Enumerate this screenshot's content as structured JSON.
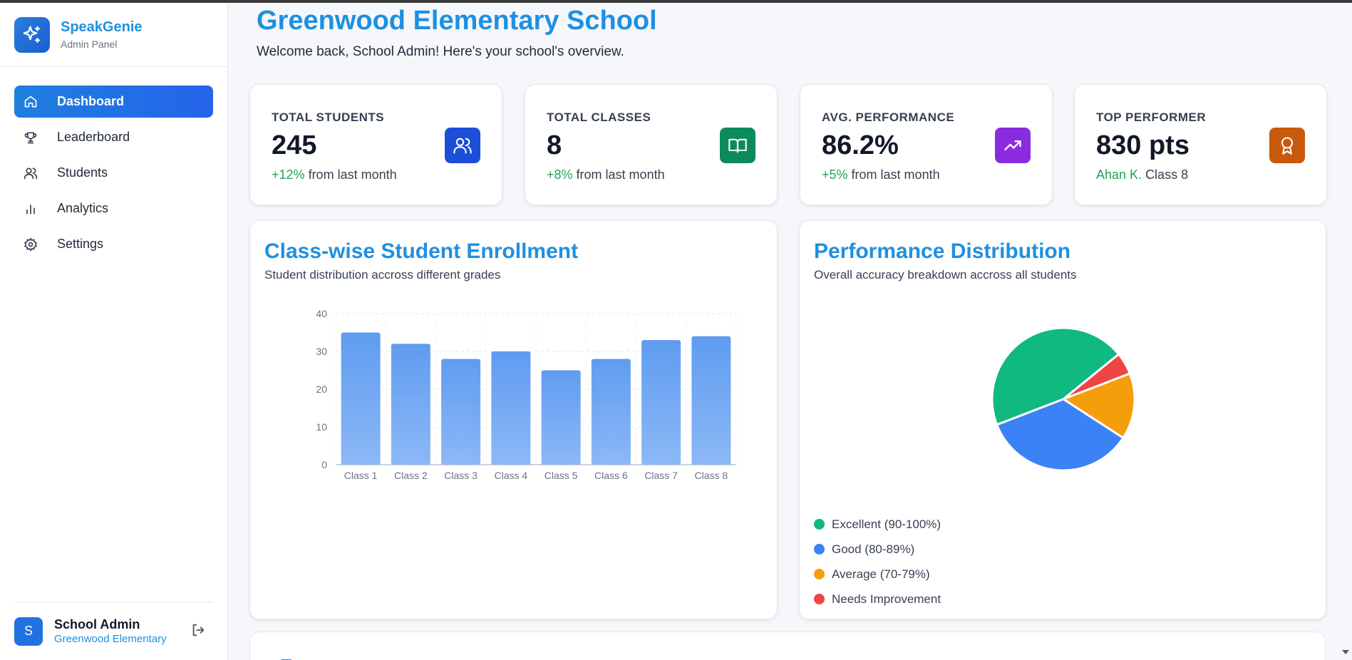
{
  "brand": {
    "name": "SpeakGenie",
    "subtitle": "Admin Panel"
  },
  "sidebar": {
    "items": [
      {
        "label": "Dashboard",
        "icon": "home-icon",
        "active": true
      },
      {
        "label": "Leaderboard",
        "icon": "trophy-icon",
        "active": false
      },
      {
        "label": "Students",
        "icon": "users-icon",
        "active": false
      },
      {
        "label": "Analytics",
        "icon": "bar-chart-icon",
        "active": false
      },
      {
        "label": "Settings",
        "icon": "gear-icon",
        "active": false
      }
    ],
    "user": {
      "avatar_letter": "S",
      "name": "School Admin",
      "org": "Greenwood Elementary"
    }
  },
  "header": {
    "title": "Greenwood Elementary School",
    "subtitle": "Welcome back, School Admin! Here's your school's overview."
  },
  "stats": [
    {
      "label": "TOTAL STUDENTS",
      "value": "245",
      "delta": "+12%",
      "note": "from last month",
      "icon": "users-icon",
      "color": "#1d4ed8"
    },
    {
      "label": "TOTAL CLASSES",
      "value": "8",
      "delta": "+8%",
      "note": "from last month",
      "icon": "book-open-icon",
      "color": "#0b8a5a"
    },
    {
      "label": "AVG. PERFORMANCE",
      "value": "86.2%",
      "delta": "+5%",
      "note": "from last month",
      "icon": "trending-up-icon",
      "color": "#8a2be2"
    },
    {
      "label": "TOP PERFORMER",
      "value": "830 pts",
      "delta": "Ahan K.",
      "note": "Class 8",
      "icon": "award-icon",
      "color": "#c85a0c"
    }
  ],
  "enrollment_panel": {
    "title": "Class-wise Student Enrollment",
    "subtitle": "Student distribution accross different grades"
  },
  "performance_panel": {
    "title": "Performance Distribution",
    "subtitle": "Overall accuracy breakdown accross all students",
    "legend": [
      {
        "label": "Excellent (90-100%)",
        "color": "#10b981"
      },
      {
        "label": "Good (80-89%)",
        "color": "#3b82f6"
      },
      {
        "label": "Average (70-79%)",
        "color": "#f59e0b"
      },
      {
        "label": "Needs Improvement",
        "color": "#ef4444"
      }
    ]
  },
  "chart_data": [
    {
      "type": "bar",
      "categories": [
        "Class 1",
        "Class 2",
        "Class 3",
        "Class 4",
        "Class 5",
        "Class 6",
        "Class 7",
        "Class 8"
      ],
      "values": [
        35,
        32,
        28,
        30,
        25,
        28,
        33,
        34
      ],
      "title": "Class-wise Student Enrollment",
      "xlabel": "",
      "ylabel": "",
      "ylim": [
        0,
        40
      ],
      "yticks": [
        0,
        10,
        20,
        30,
        40
      ],
      "grid": true,
      "bar_color": "#6aa3f2"
    },
    {
      "type": "pie",
      "title": "Performance Distribution",
      "labels": [
        "Excellent (90-100%)",
        "Needs Improvement",
        "Average (70-79%)",
        "Good (80-89%)"
      ],
      "values": [
        45,
        5,
        15,
        35
      ],
      "colors": [
        "#10b981",
        "#ef4444",
        "#f59e0b",
        "#3b82f6"
      ],
      "legend": "bottom-left"
    }
  ]
}
